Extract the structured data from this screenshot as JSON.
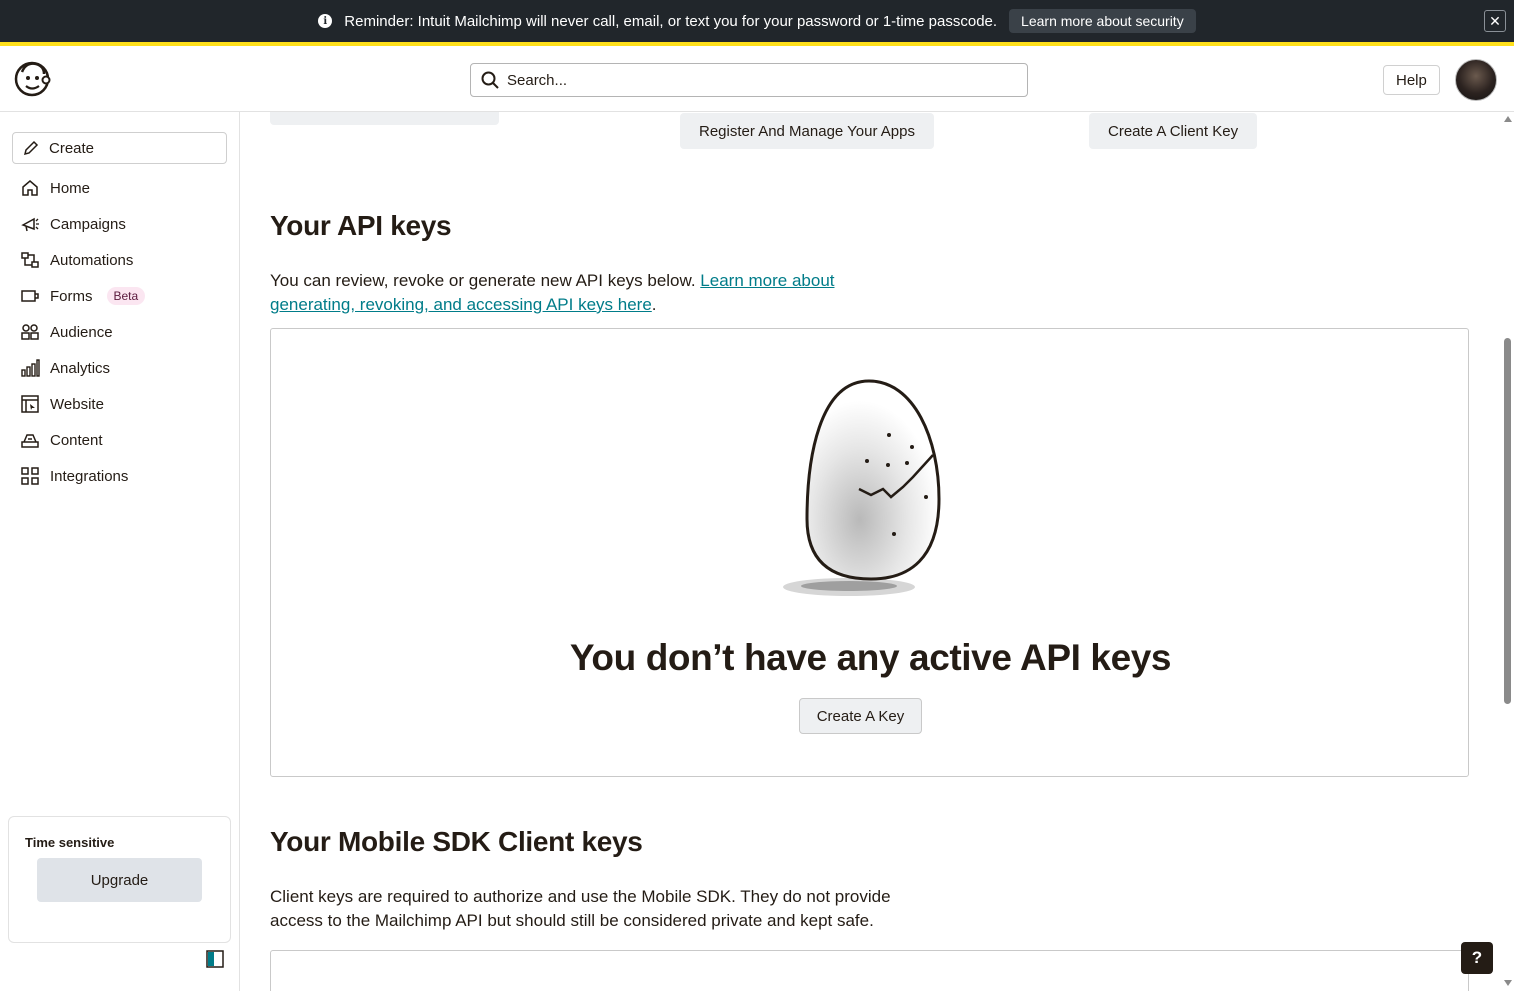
{
  "banner": {
    "text": "Reminder: Intuit Mailchimp will never call, email, or text you for your password or 1-time passcode.",
    "link_label": "Learn more about security",
    "close_glyph": "✕"
  },
  "header": {
    "search_placeholder": "Search...",
    "help_label": "Help"
  },
  "sidebar": {
    "create_label": "Create",
    "items": [
      {
        "label": "Home",
        "icon": "home-icon"
      },
      {
        "label": "Campaigns",
        "icon": "megaphone-icon"
      },
      {
        "label": "Automations",
        "icon": "automation-icon"
      },
      {
        "label": "Forms",
        "icon": "form-icon",
        "badge": "Beta"
      },
      {
        "label": "Audience",
        "icon": "audience-icon"
      },
      {
        "label": "Analytics",
        "icon": "bar-chart-icon"
      },
      {
        "label": "Website",
        "icon": "website-icon"
      },
      {
        "label": "Content",
        "icon": "content-icon"
      },
      {
        "label": "Integrations",
        "icon": "grid-icon"
      }
    ],
    "upgrade_card": {
      "label": "Time sensitive",
      "button": "Upgrade"
    }
  },
  "main": {
    "top_buttons": {
      "register": "Register And Manage Your Apps",
      "client_key": "Create A Client Key"
    },
    "api_section": {
      "title": "Your API keys",
      "description": "You can review, revoke or generate new API keys below. ",
      "link": "Learn more about generating, revoking, and accessing API keys here",
      "period": ".",
      "empty_title": "You don’t have any active API keys",
      "create_button": "Create A Key"
    },
    "sdk_section": {
      "title": "Your Mobile SDK Client keys",
      "description": "Client keys are required to authorize and use the Mobile SDK. They do not provide access to the Mailchimp API but should still be considered private and kept safe."
    }
  },
  "help_fab": "?",
  "colors": {
    "banner_bg": "#21262b",
    "banner_accent": "#ffe01b",
    "link": "#007c89",
    "button_bg": "#eef0f2"
  }
}
